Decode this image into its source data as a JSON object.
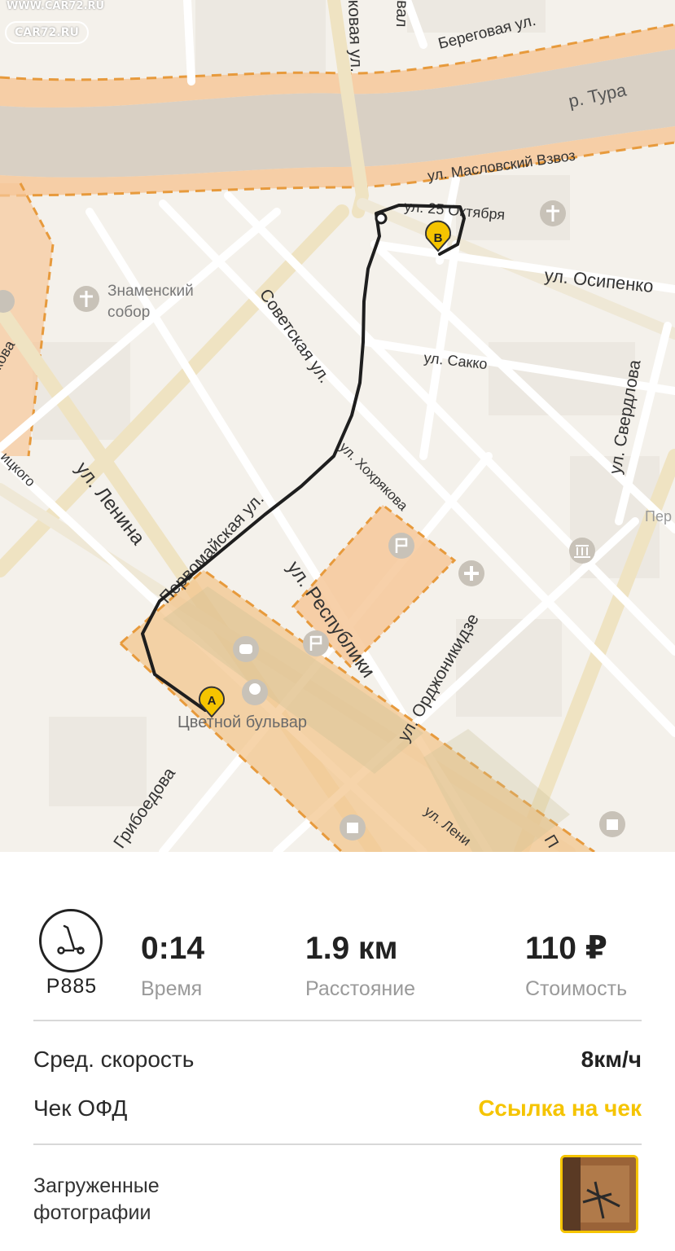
{
  "watermark": {
    "url": "WWW.CAR72.RU",
    "logo": "CAR72.RU"
  },
  "map": {
    "streets": {
      "beregovaya": "Береговая ул.",
      "tura": "р. Тура",
      "maslovsky": "ул. Масловский Взвоз",
      "oktyabrya25": "ул. 25 Октября",
      "osipenko": "ул. Осипенко",
      "znamensky": "Знаменский",
      "sobor": "собор",
      "sovetskaya": "Советская ул.",
      "sakko": "ул. Сакко",
      "sverdlova": "ул. Свердлова",
      "khokhryakova": "ул. Хохрякова",
      "lenina": "ул. Ленина",
      "pervomayskaya": "Первомайская ул.",
      "respubliki": "ул. Республики",
      "ordzhonikidze": "ул. Орджоникидзе",
      "tsvetnoy": "Цветной бульвар",
      "griboedova": "Грибоедова",
      "lenina2": "ул. Лени",
      "kovaya": "ковая ул.",
      "val": "вал",
      "kova": "кова",
      "itskogo": "ицкого",
      "pera": "Пер",
      "ul_short": "П"
    },
    "markers": {
      "start": "A",
      "end": "B"
    },
    "colors": {
      "route": "#1e1e1e",
      "marker": "#f5c400",
      "zone": "#f6c89a",
      "zone_border": "#e79a3c",
      "river": "#d8cfc3"
    }
  },
  "trip": {
    "icon": "scooter-icon",
    "vehicle_id": "P885",
    "time": {
      "value": "0:14",
      "label": "Время"
    },
    "distance": {
      "value": "1.9 км",
      "label": "Расстояние"
    },
    "cost": {
      "value": "110 ₽",
      "label": "Стоимость"
    },
    "avg_speed": {
      "label": "Сред. скорость",
      "value": "8км/ч"
    },
    "receipt": {
      "label": "Чек ОФД",
      "link": "Ссылка на чек"
    },
    "photos": {
      "label": "Загруженные фотографии"
    }
  }
}
